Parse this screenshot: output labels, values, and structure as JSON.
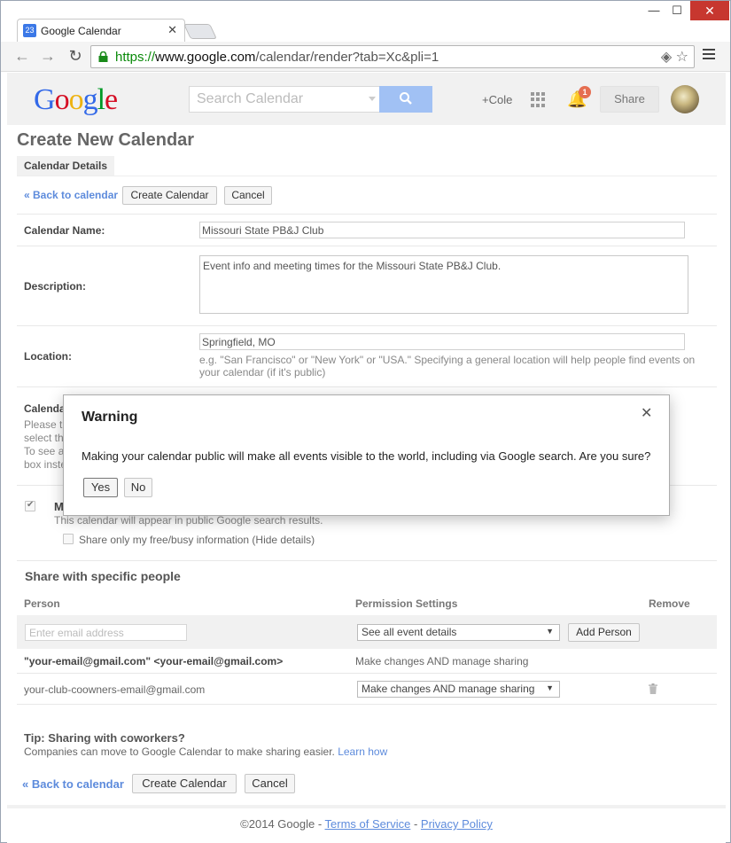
{
  "browser": {
    "tab_title": "Google Calendar",
    "favicon_text": "23",
    "url_scheme": "https://",
    "url_host": "www.google.com",
    "url_path": "/calendar/render?tab=Xc&pli=1",
    "min_glyph": "—",
    "max_glyph": "☐",
    "close_glyph": "✕"
  },
  "gbar": {
    "logo_letters": [
      "G",
      "o",
      "o",
      "g",
      "l",
      "e"
    ],
    "search_placeholder": "Search Calendar",
    "plus_name": "+Cole",
    "notification_count": "1",
    "share_label": "Share"
  },
  "page": {
    "title": "Create New Calendar",
    "details_tab": "Calendar Details",
    "back_link": "« Back to calendar",
    "create_button": "Create Calendar",
    "cancel_button": "Cancel"
  },
  "form": {
    "name_label": "Calendar Name:",
    "name_value": "Missouri State PB&J Club",
    "description_label": "Description:",
    "description_value": "Event info and meeting times for the Missouri State PB&J Club.",
    "location_label": "Location:",
    "location_value": "Springfield, MO",
    "location_hint": "e.g. \"San Francisco\" or \"New York\" or \"USA.\" Specifying a general location will help people find events on your calendar (if it's public)",
    "hidden_fragments": [
      "Calenda",
      "Please t",
      "select th",
      "To see a",
      "box inste"
    ],
    "public_fragment": "M",
    "public_hint": "This calendar will appear in public Google search results.",
    "free_busy_label": "Share only my free/busy information (Hide details)"
  },
  "sharing": {
    "title": "Share with specific people",
    "col_person": "Person",
    "col_permission": "Permission Settings",
    "col_remove": "Remove",
    "email_placeholder": "Enter email address",
    "new_permission": "See all event details",
    "add_person": "Add Person",
    "rows": [
      {
        "person": "\"your-email@gmail.com\" <your-email@gmail.com>",
        "permission": "Make changes AND manage sharing"
      },
      {
        "person": "your-club-coowners-email@gmail.com",
        "permission": "Make changes AND manage sharing"
      }
    ]
  },
  "tip": {
    "title": "Tip: Sharing with coworkers?",
    "text": "Companies can move to Google Calendar to make sharing easier.",
    "link": "Learn how"
  },
  "footer": {
    "copyright": "©2014 Google",
    "separator": " - ",
    "terms": "Terms of Service",
    "privacy": "Privacy Policy"
  },
  "dialog": {
    "title": "Warning",
    "message": "Making your calendar public will make all events visible to the world, including via Google search. Are you sure?",
    "yes": "Yes",
    "no": "No",
    "close_glyph": "✕"
  }
}
